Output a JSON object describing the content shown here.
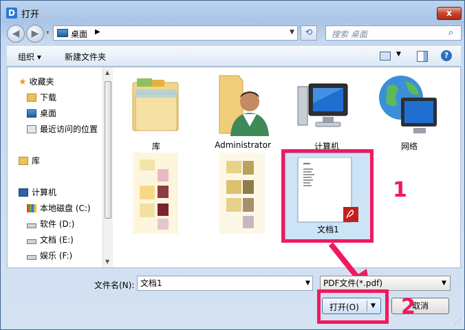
{
  "window": {
    "title": "打开",
    "app_icon": "D",
    "close": "x"
  },
  "nav": {
    "back": "◀",
    "forward": "▶",
    "history_dropdown": "▾"
  },
  "address": {
    "location": "桌面",
    "arrow": "▶",
    "dropdown": "▼"
  },
  "search": {
    "placeholder": "搜索 桌面"
  },
  "toolbar": {
    "organize": "组织 ▾",
    "new_folder": "新建文件夹",
    "view_dropdown": "▼",
    "help": "?"
  },
  "sidebar": {
    "favorites": "收藏夹",
    "downloads": "下载",
    "desktop": "桌面",
    "recent": "最近访问的位置",
    "libraries": "库",
    "computer": "计算机",
    "drive_c": "本地磁盘 (C:)",
    "drive_d": "软件 (D:)",
    "drive_e": "文档 (E:)",
    "drive_f": "娱乐 (F:)"
  },
  "files": {
    "library": "库",
    "administrator": "Administrator",
    "computer": "计算机",
    "network": "网络",
    "document": "文档1"
  },
  "bottom": {
    "filename_label": "文件名(N):",
    "filename_value": "文档1",
    "filetype_value": "PDF文件(*.pdf)",
    "open_label": "打开(O)",
    "cancel_label": "取消"
  },
  "annotations": {
    "step1": "1",
    "step2": "2"
  },
  "colors": {
    "highlight": "#f2185f",
    "selection": "#cde4f7"
  }
}
